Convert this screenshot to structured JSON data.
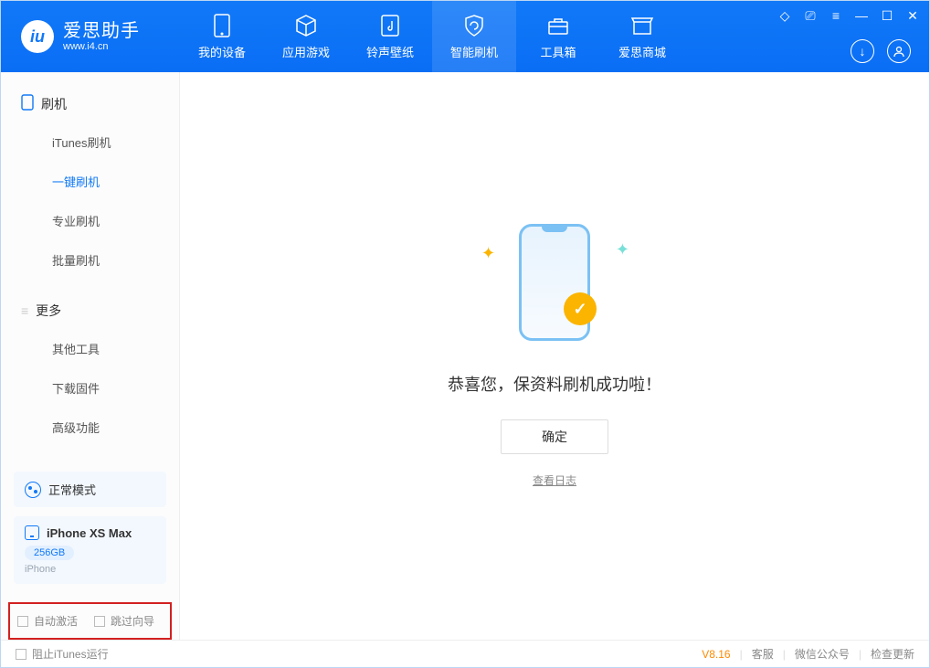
{
  "brand": {
    "title": "爱思助手",
    "subtitle": "www.i4.cn"
  },
  "tabs": [
    "我的设备",
    "应用游戏",
    "铃声壁纸",
    "智能刷机",
    "工具箱",
    "爱思商城"
  ],
  "activeTab": 3,
  "sidebar": {
    "section1": {
      "title": "刷机",
      "items": [
        "iTunes刷机",
        "一键刷机",
        "专业刷机",
        "批量刷机"
      ]
    },
    "section2": {
      "title": "更多",
      "items": [
        "其他工具",
        "下载固件",
        "高级功能"
      ]
    },
    "activeItem": "一键刷机",
    "mode": "正常模式",
    "device": {
      "name": "iPhone XS Max",
      "storage": "256GB",
      "type": "iPhone"
    },
    "redBox": {
      "chk1": "自动激活",
      "chk2": "跳过向导"
    }
  },
  "main": {
    "successText": "恭喜您，保资料刷机成功啦！",
    "okBtn": "确定",
    "viewLog": "查看日志"
  },
  "footer": {
    "blockItunes": "阻止iTunes运行",
    "version": "V8.16",
    "links": [
      "客服",
      "微信公众号",
      "检查更新"
    ]
  }
}
